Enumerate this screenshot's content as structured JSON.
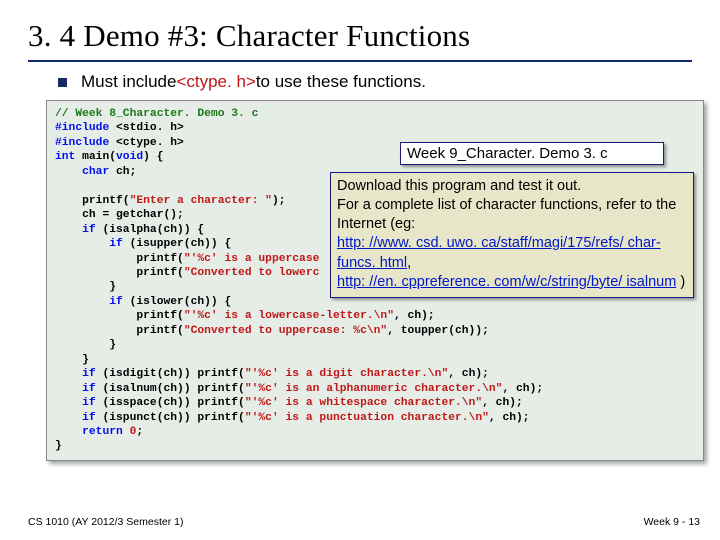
{
  "title": "3. 4 Demo #3: Character Functions",
  "bullet": {
    "prefix": "Must include ",
    "header": "<ctype. h>",
    "suffix": " to use these functions."
  },
  "code": {
    "comment": "// Week 8_Character. Demo 3. c",
    "inc1a": "#include ",
    "inc1b": "<stdio. h>",
    "inc2a": "#include ",
    "inc2b": "<ctype. h>",
    "l4a": "int",
    "l4b": " main(",
    "l4c": "void",
    "l4d": ") {",
    "l5a": "    char",
    "l5b": " ch;",
    "l6": "",
    "l7a": "    printf(",
    "l7b": "\"Enter a character: \"",
    "l7c": ");",
    "l8": "    ch = getchar();",
    "l9a": "    if",
    "l9b": " (isalpha(ch)) {",
    "l10a": "        if",
    "l10b": " (isupper(ch)) {",
    "l11a": "            printf(",
    "l11b": "\"'%c' is a uppercase",
    "l12a": "            printf(",
    "l12b": "\"Converted to lowerc",
    "l13": "        }",
    "l14a": "        if",
    "l14b": " (islower(ch)) {",
    "l15a": "            printf(",
    "l15b": "\"'%c' is a lowercase-letter.\\n\"",
    "l15c": ", ch);",
    "l16a": "            printf(",
    "l16b": "\"Converted to uppercase: %c\\n\"",
    "l16c": ", toupper(ch));",
    "l17": "        }",
    "l18": "    }",
    "l19a": "    if",
    "l19b": " (isdigit(ch)) printf(",
    "l19c": "\"'%c' is a digit character.\\n\"",
    "l19d": ", ch);",
    "l20a": "    if",
    "l20b": " (isalnum(ch)) printf(",
    "l20c": "\"'%c' is an alphanumeric character.\\n\"",
    "l20d": ", ch);",
    "l21a": "    if",
    "l21b": " (isspace(ch)) printf(",
    "l21c": "\"'%c' is a whitespace character.\\n\"",
    "l21d": ", ch);",
    "l22a": "    if",
    "l22b": " (ispunct(ch)) printf(",
    "l22c": "\"'%c' is a punctuation character.\\n\"",
    "l22d": ", ch);",
    "l23a": "    return ",
    "l23b": "0",
    "l23c": ";",
    "l24": "}"
  },
  "overlay_file": "Week 9_Character. Demo 3. c",
  "desc": {
    "p1": "Download this program and test it out.",
    "p2": "For a complete list of character functions, refer to the Internet (eg:",
    "link1": "http: //www. csd. uwo. ca/staff/magi/175/refs/ char-funcs. html",
    "comma": ",",
    "link2": "http: //en. cppreference. com/w/c/string/byte/ isalnum",
    "close": " )"
  },
  "footer_left": "CS 1010 (AY 2012/3 Semester 1)",
  "footer_right": "Week 9 - 13"
}
